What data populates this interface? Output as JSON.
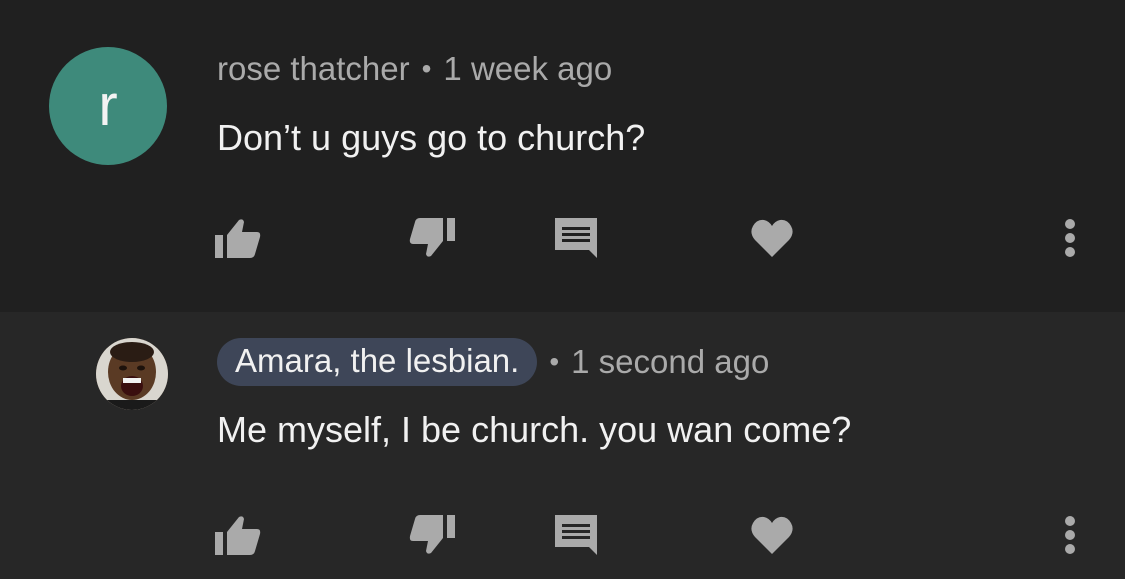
{
  "comments": [
    {
      "author": "rose thatcher",
      "separator": "•",
      "time": "1 week ago",
      "text": "Don’t u guys go to church?",
      "avatar_letter": "r",
      "avatar_color": "#3e8a7b"
    },
    {
      "author": "Amara, the lesbian.",
      "separator": "•",
      "time": "1 second ago",
      "text": "Me myself, I be church. you wan come?",
      "avatar": "profile-photo",
      "author_chip_color": "#3e4658"
    }
  ],
  "icons": {
    "like": "thumbs-up-icon",
    "dislike": "thumbs-down-icon",
    "reply": "reply-comment-icon",
    "heart": "heart-icon",
    "more": "more-vertical-icon"
  },
  "colors": {
    "background": "#202020",
    "reply_background": "#272727",
    "icon": "#aaaaaa"
  }
}
